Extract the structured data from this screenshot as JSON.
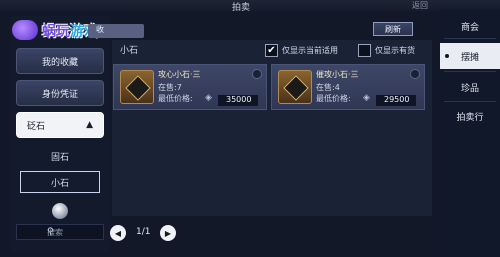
{
  "top": {
    "title": "拍卖",
    "right_hint": "返回"
  },
  "watermark": {
    "brand_a": "蜗玩",
    "brand_b": "游戏"
  },
  "left_tab_hint": "收",
  "sidebar": {
    "favorites": "我的收藏",
    "identity": "身份凭证",
    "category": "砭石",
    "category_arrow": "▲",
    "sub_items": [
      "固石",
      "小石"
    ],
    "selected_sub": "小石"
  },
  "search": {
    "placeholder": "搜索"
  },
  "pager": {
    "prev": "◀",
    "page_text": "1/1",
    "next": "▶"
  },
  "main": {
    "title": "小石",
    "check_applicable": "仅显示当前适用",
    "check_in_stock": "仅显示有货",
    "refresh": "刷新"
  },
  "items": [
    {
      "name": "攻心小石·三",
      "stock_label": "在售:",
      "stock": "7",
      "price_label": "最低价格:",
      "price": "35000"
    },
    {
      "name": "催攻小石·三",
      "stock_label": "在售:",
      "stock": "4",
      "price_label": "最低价格:",
      "price": "29500"
    }
  ],
  "right_nav": [
    "商会",
    "摆摊",
    "珍品",
    "拍卖行"
  ],
  "right_nav_active": "摆摊",
  "colors": {
    "accent": "#e9ecf2",
    "panel": "#1a2236",
    "card": "#3e4766"
  }
}
